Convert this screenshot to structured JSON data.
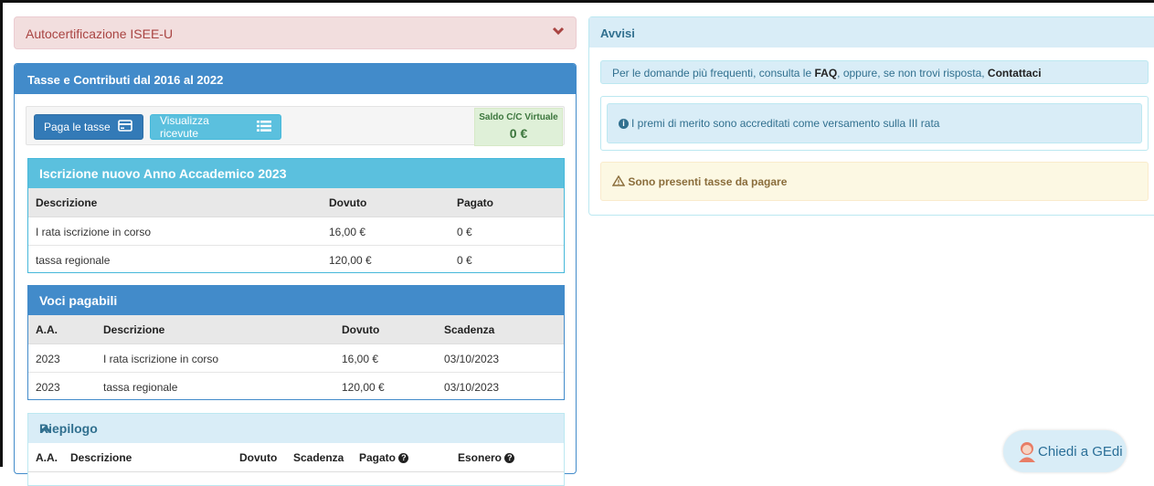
{
  "isee": {
    "title": "Autocertificazione ISEE-U",
    "icon": "chevron-down-icon"
  },
  "tasse": {
    "title": "Tasse e Contributi dal 2016 al 2022",
    "paga_label": "Paga le tasse",
    "visualizza_label": "Visualizza ricevute",
    "saldo_label": "Saldo C/C Virtuale",
    "saldo_value": "0 €"
  },
  "iscrizione": {
    "title": "Iscrizione nuovo Anno Accademico 2023",
    "headers": [
      "Descrizione",
      "Dovuto",
      "Pagato"
    ],
    "rows": [
      [
        "I rata iscrizione in corso",
        "16,00 €",
        "0 €"
      ],
      [
        "tassa regionale",
        "120,00 €",
        "0 €"
      ]
    ]
  },
  "voci": {
    "title": "Voci pagabili",
    "headers": [
      "A.A.",
      "Descrizione",
      "Dovuto",
      "Scadenza"
    ],
    "rows": [
      [
        "2023",
        "I rata iscrizione in corso",
        "16,00 €",
        "03/10/2023"
      ],
      [
        "2023",
        "tassa regionale",
        "120,00 €",
        "03/10/2023"
      ]
    ]
  },
  "riepilogo": {
    "title": "Riepilogo",
    "headers": [
      "A.A.",
      "Descrizione",
      "Dovuto",
      "Scadenza",
      "Pagato",
      "Esonero"
    ]
  },
  "avvisi": {
    "title": "Avvisi",
    "faq_pre": "Per le domande più frequenti, consulta le ",
    "faq_link": "FAQ",
    "faq_mid": ", oppure, se non trovi risposta, ",
    "contact_link": "Contattaci",
    "premi": "I premi di merito sono accreditati come versamento sulla III rata",
    "tasse_alert": "Sono presenti tasse da pagare"
  },
  "chat": {
    "label": "Chiedi a GEdi"
  },
  "colors": {
    "primary": "#428bca",
    "info": "#5bc0de",
    "danger_bg": "#f2dede",
    "warning_bg": "#fcf8e3",
    "success_bg": "#dff0d8"
  }
}
